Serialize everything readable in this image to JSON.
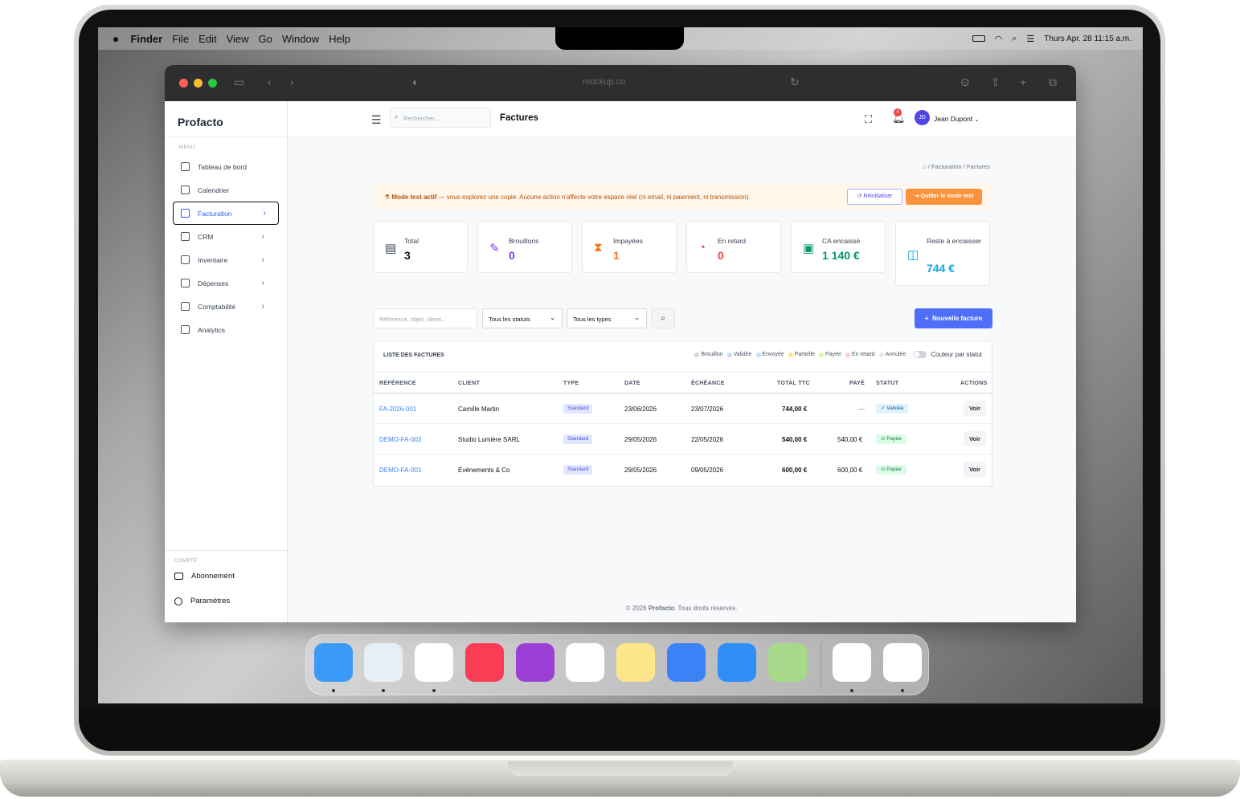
{
  "menubar": {
    "apple": "",
    "app": "Finder",
    "items": [
      "File",
      "Edit",
      "View",
      "Go",
      "Window",
      "Help"
    ],
    "clock": "Thurs Apr. 28 11:15 a.m."
  },
  "browser": {
    "url": "mockup.co"
  },
  "sidebar": {
    "brand": "Profacto",
    "menu_label": "MENU",
    "items": [
      {
        "label": "Tableau de bord",
        "chevron": ""
      },
      {
        "label": "Calendrier",
        "chevron": ""
      },
      {
        "label": "Facturation",
        "chevron": "›"
      },
      {
        "label": "CRM",
        "chevron": "›"
      },
      {
        "label": "Inventaire",
        "chevron": "›"
      },
      {
        "label": "Dépenses",
        "chevron": "›"
      },
      {
        "label": "Comptabilité",
        "chevron": "›"
      },
      {
        "label": "Analytics",
        "chevron": ""
      }
    ],
    "account_label": "COMPTE",
    "account_items": [
      "Abonnement",
      "Paramètres"
    ]
  },
  "header": {
    "search_placeholder": "Rechercher...",
    "title": "Factures",
    "notif_count": "4",
    "user_initials": "JD",
    "user_name": "Jean Dupont"
  },
  "breadcrumb": [
    "Facturation",
    "Factures"
  ],
  "banner": {
    "bold": "Mode test actif",
    "text": " — vous explorez une copie. Aucune action n'affecte votre espace réel (ni email, ni paiement, ni transmission).",
    "reset_label": "Réinitialiser",
    "quit_label": "Quitter le mode test"
  },
  "stats": [
    {
      "label": "Total",
      "value": "3",
      "color": "#111111"
    },
    {
      "label": "Brouillons",
      "value": "0",
      "color": "#7c3aed"
    },
    {
      "label": "Impayées",
      "value": "1",
      "color": "#f97316"
    },
    {
      "label": "En retard",
      "value": "0",
      "color": "#ef4444"
    },
    {
      "label": "CA encaissé",
      "value": "1 140 €",
      "color": "#059669"
    },
    {
      "label": "Reste à encaisser",
      "value": "744 €",
      "color": "#0ea5e9"
    }
  ],
  "filters": {
    "search_placeholder": "Référence, objet, client...",
    "status": "Tous les statuts",
    "type": "Tous les types",
    "new_label": "Nouvelle facture"
  },
  "table": {
    "title": "LISTE DES FACTURES",
    "legend": [
      {
        "label": "Brouillon",
        "color": "#d1d5db"
      },
      {
        "label": "Validée",
        "color": "#bfdbfe"
      },
      {
        "label": "Envoyée",
        "color": "#bae6fd"
      },
      {
        "label": "Partielle",
        "color": "#fde68a"
      },
      {
        "label": "Payée",
        "color": "#d9f99d"
      },
      {
        "label": "En retard",
        "color": "#fecaca"
      },
      {
        "label": "Annulée",
        "color": "#e5e7eb"
      }
    ],
    "color_toggle_label": "Couleur par statut",
    "headers": [
      "RÉFÉRENCE",
      "CLIENT",
      "TYPE",
      "DATE",
      "ÉCHÉANCE",
      "TOTAL TTC",
      "PAYÉ",
      "STATUT",
      "ACTIONS"
    ],
    "rows": [
      {
        "ref": "FA-2026-001",
        "client": "Camille Martin",
        "type": "Standard",
        "date": "23/06/2026",
        "due": "23/07/2026",
        "total": "744,00 €",
        "paid": "—",
        "status": "✓ Validée",
        "status_kind": "val",
        "action": "Voir"
      },
      {
        "ref": "DEMO-FA-002",
        "client": "Studio Lumière SARL",
        "type": "Standard",
        "date": "29/05/2026",
        "due": "22/05/2026",
        "total": "540,00 €",
        "paid": "540,00 €",
        "status": "⊙ Payée",
        "status_kind": "pay",
        "action": "Voir"
      },
      {
        "ref": "DEMO-FA-001",
        "client": "Évènements & Co",
        "type": "Standard",
        "date": "29/05/2026",
        "due": "09/05/2026",
        "total": "600,00 €",
        "paid": "600,00 €",
        "status": "⊙ Payée",
        "status_kind": "pay",
        "action": "Voir"
      }
    ]
  },
  "footer": {
    "prefix": "© 2026 ",
    "brand": "Profacto",
    "suffix": ". Tous droits réservés."
  },
  "dock": [
    {
      "name": "finder",
      "color": "#3b9af7"
    },
    {
      "name": "safari",
      "color": "#e8eef5"
    },
    {
      "name": "slack",
      "color": "#ffffff"
    },
    {
      "name": "music",
      "color": "#fa3c55"
    },
    {
      "name": "podcasts",
      "color": "#9b3fd6"
    },
    {
      "name": "reminders",
      "color": "#ffffff"
    },
    {
      "name": "notes",
      "color": "#fde68a"
    },
    {
      "name": "mail",
      "color": "#3b82f6"
    },
    {
      "name": "app-store",
      "color": "#2f8ef7"
    },
    {
      "name": "maps",
      "color": "#a7d98b"
    },
    {
      "name": "photos",
      "color": "#ffffff"
    },
    {
      "name": "news",
      "color": "#ffffff"
    }
  ]
}
